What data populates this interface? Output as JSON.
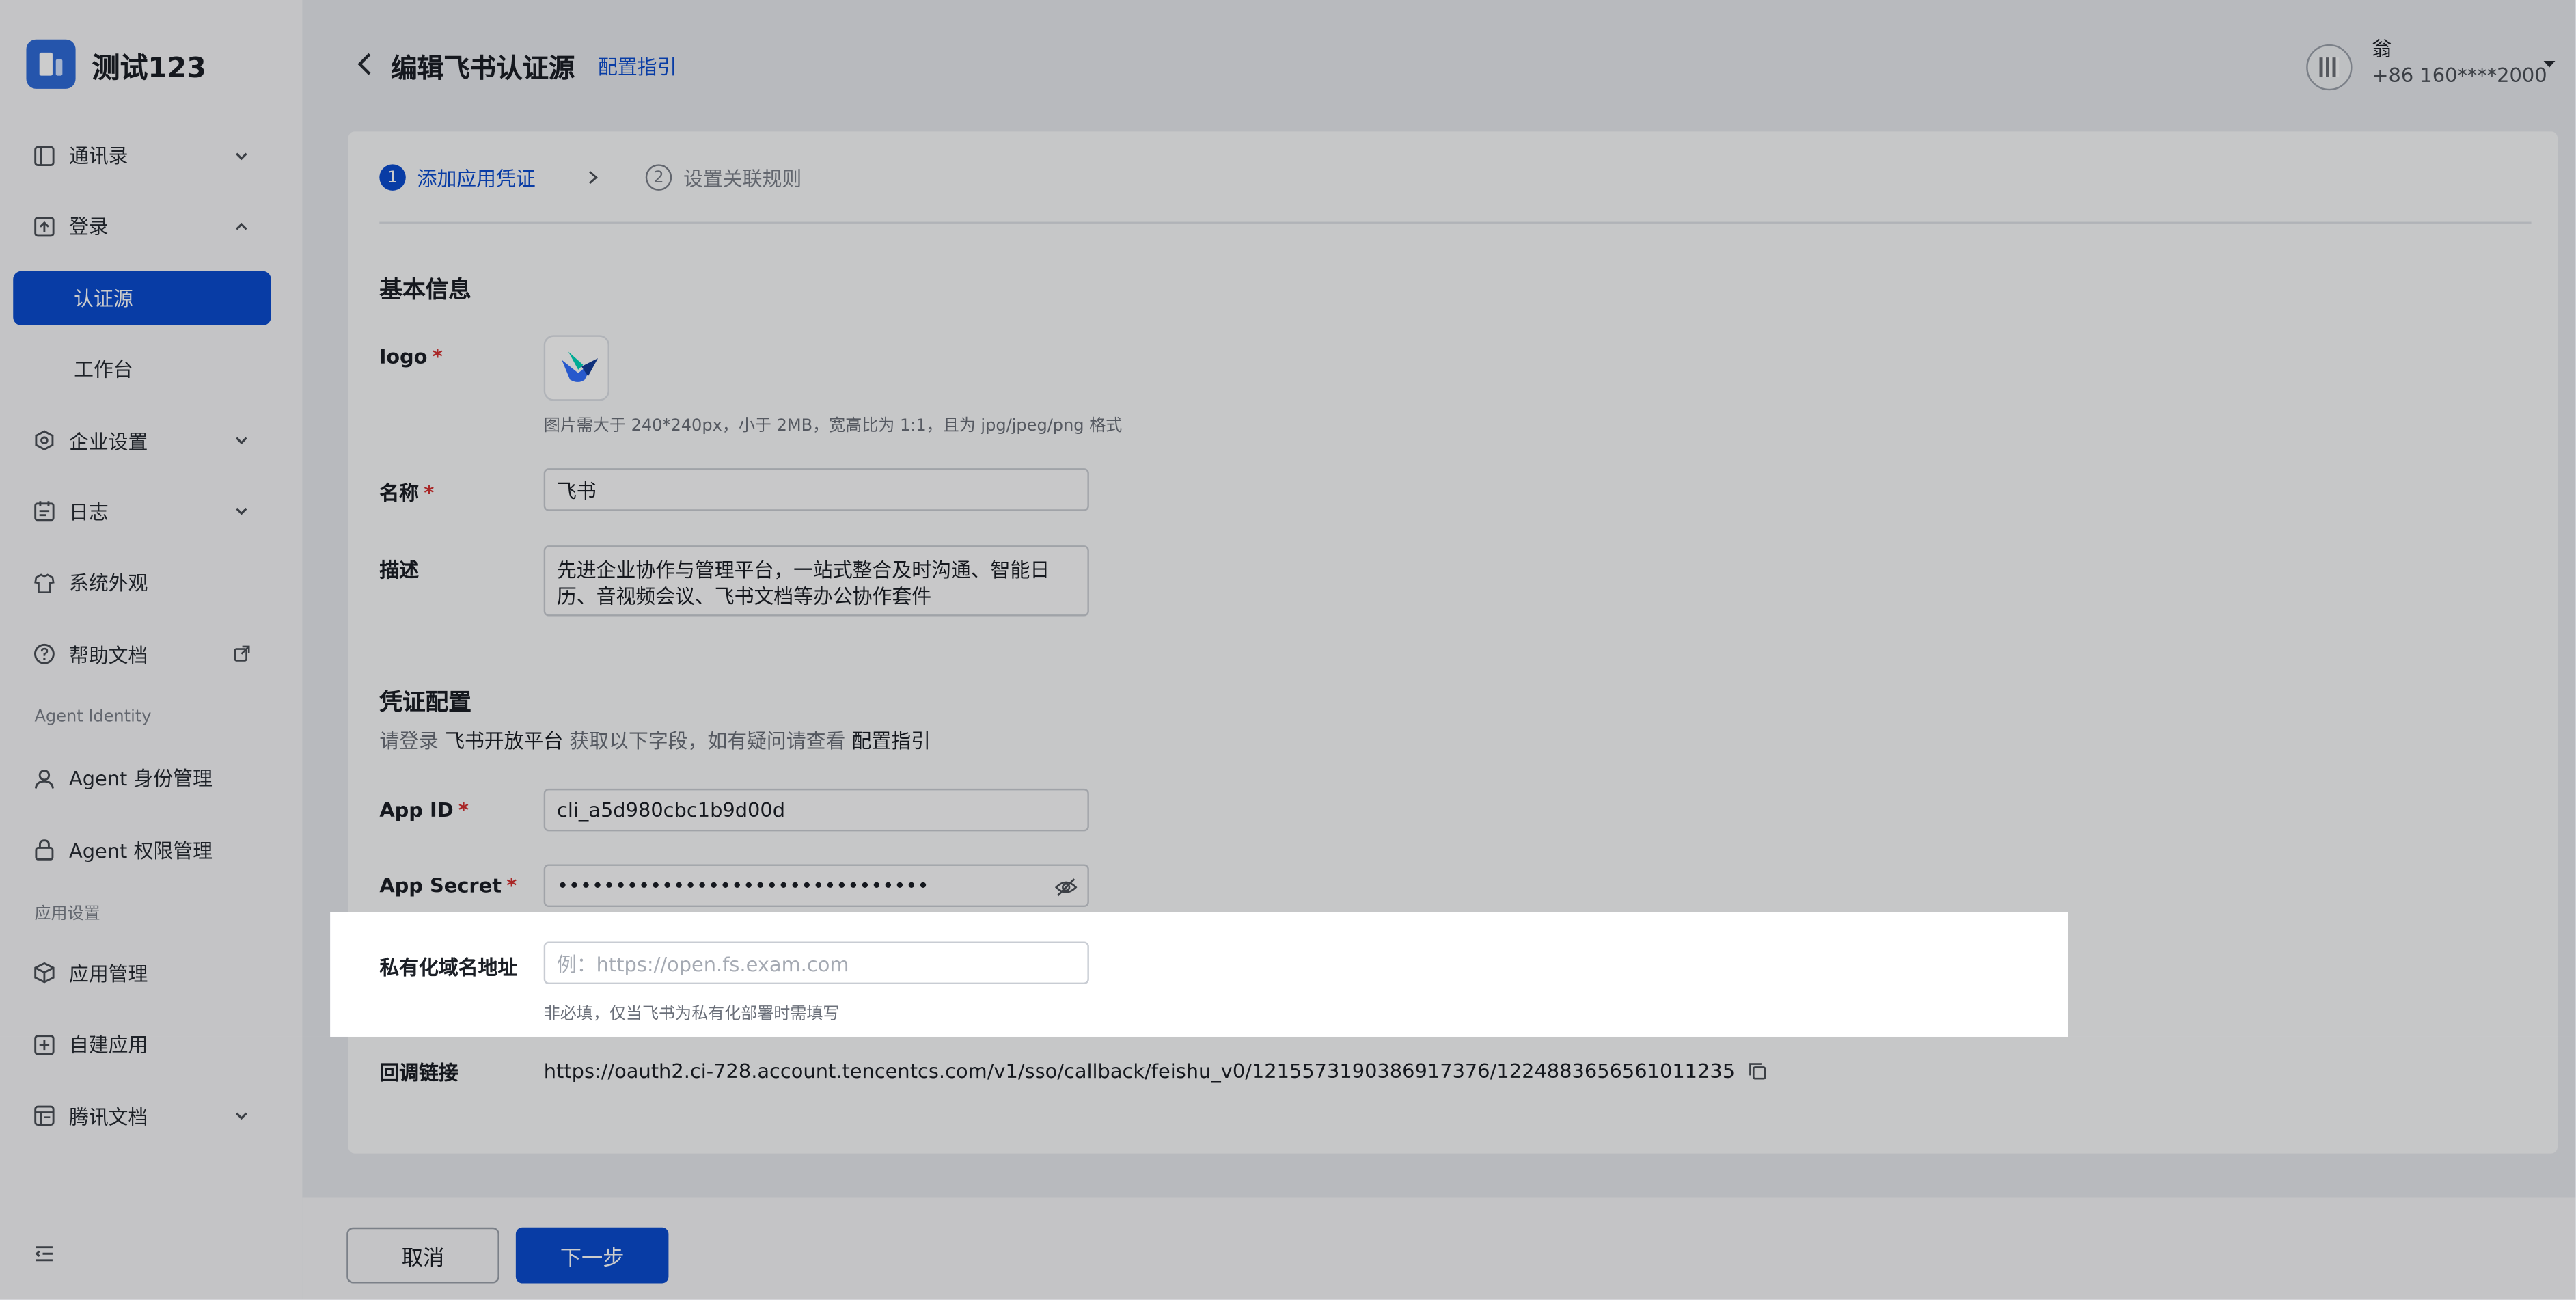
{
  "brand": {
    "name": "测试123"
  },
  "sidebar": {
    "items": [
      {
        "label": "通讯录",
        "icon": "contacts-book-icon",
        "expand": "down"
      },
      {
        "label": "登录",
        "icon": "login-icon",
        "expand": "up"
      },
      {
        "label": "认证源",
        "active": true
      },
      {
        "label": "工作台"
      },
      {
        "label": "企业设置",
        "icon": "settings-icon",
        "expand": "down"
      },
      {
        "label": "日志",
        "icon": "log-icon",
        "expand": "down"
      },
      {
        "label": "系统外观",
        "icon": "shirt-icon"
      },
      {
        "label": "帮助文档",
        "icon": "help-icon",
        "external": true
      }
    ],
    "section_agent": "Agent Identity",
    "agent_items": [
      {
        "label": "Agent 身份管理",
        "icon": "user-icon"
      },
      {
        "label": "Agent 权限管理",
        "icon": "lock-icon"
      }
    ],
    "section_apps": "应用设置",
    "app_items": [
      {
        "label": "应用管理",
        "icon": "cube-icon"
      },
      {
        "label": "自建应用",
        "icon": "add-box-icon"
      },
      {
        "label": "腾讯文档",
        "icon": "doc-icon",
        "expand": "down"
      }
    ]
  },
  "header": {
    "title": "编辑飞书认证源",
    "guide_link": "配置指引",
    "user_name": "翁",
    "user_phone": "+86 160****2000"
  },
  "steps": [
    {
      "num": "1",
      "label": "添加应用凭证",
      "active": true
    },
    {
      "num": "2",
      "label": "设置关联规则",
      "active": false
    }
  ],
  "form": {
    "basic_title": "基本信息",
    "logo_label": "logo",
    "logo_hint": "图片需大于 240*240px，小于 2MB，宽高比为 1:1，且为 jpg/jpeg/png 格式",
    "name_label": "名称",
    "name_value": "飞书",
    "desc_label": "描述",
    "desc_value": "先进企业协作与管理平台，一站式整合及时沟通、智能日历、音视频会议、飞书文档等办公协作套件",
    "cred_title": "凭证配置",
    "cred_desc_prefix": "请登录",
    "cred_desc_platform": "飞书开放平台",
    "cred_desc_middle": "获取以下字段，如有疑问请查看",
    "cred_desc_guide": "配置指引",
    "appid_label": "App ID",
    "appid_value": "cli_a5d980cbc1b9d00d",
    "secret_label": "App Secret",
    "secret_value": "••••••••••••••••••••••••••••••••",
    "domain_label": "私有化域名地址",
    "domain_placeholder": "例：https://open.fs.exam.com",
    "domain_hint": "非必填，仅当飞书为私有化部署时需填写",
    "callback_label": "回调链接",
    "callback_value": "https://oauth2.ci-728.account.tencentcs.com/v1/sso/callback/feishu_v0/1215573190386917376/1224883656561011235"
  },
  "footer": {
    "cancel": "取消",
    "next": "下一步"
  },
  "colors": {
    "primary": "#0b4ccf",
    "required": "#d43030"
  }
}
